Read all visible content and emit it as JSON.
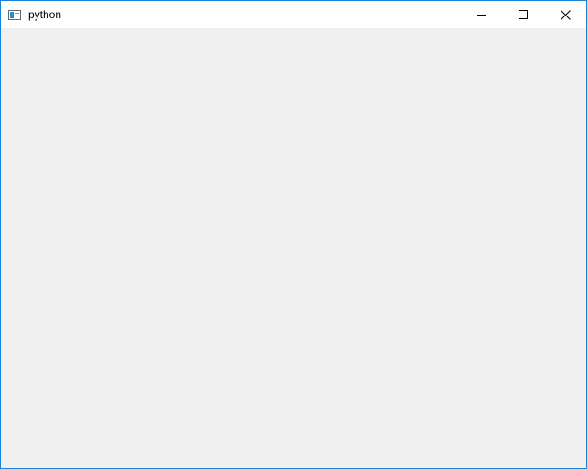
{
  "window": {
    "title": "python",
    "border_color": "#1883d7",
    "client_background": "#f0f0f0",
    "titlebar_background": "#ffffff"
  },
  "titlebar": {
    "icon": "python-window-icon",
    "controls": [
      {
        "name": "minimize",
        "icon": "minimize-icon"
      },
      {
        "name": "maximize",
        "icon": "maximize-icon"
      },
      {
        "name": "close",
        "icon": "close-icon"
      }
    ]
  }
}
